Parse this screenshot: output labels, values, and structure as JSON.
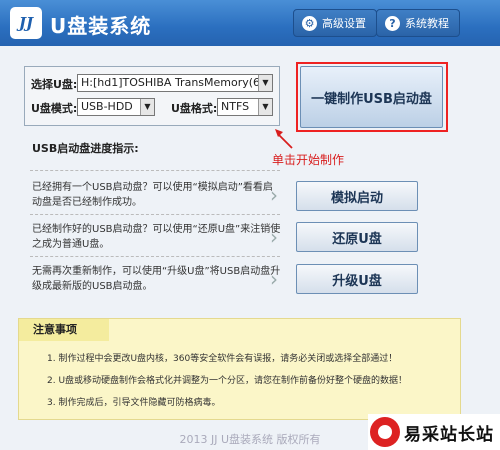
{
  "app": {
    "logo": "JJ",
    "title": "U盘装系统"
  },
  "header": {
    "settings_label": "高级设置",
    "tutorial_label": "系统教程"
  },
  "options": {
    "usb_label": "选择U盘:",
    "usb_value": "H:[hd1]TOSHIBA TransMemory(6.87G",
    "mode_label": "U盘模式:",
    "mode_value": "USB-HDD",
    "format_label": "U盘格式:",
    "format_value": "NTFS"
  },
  "oneclick_label": "一键制作USB启动盘",
  "hint_text": "单击开始制作",
  "progress_title": "USB启动盘进度指示:",
  "actions": [
    {
      "desc": "已经拥有一个USB启动盘？可以使用“模拟启动”看看启动盘是否已经制作成功。",
      "label": "模拟启动"
    },
    {
      "desc": "已经制作好的USB启动盘？可以使用“还原U盘”来注销使之成为普通U盘。",
      "label": "还原U盘"
    },
    {
      "desc": "无需再次重新制作，可以使用“升级U盘”将USB启动盘升级成最新版的USB启动盘。",
      "label": "升级U盘"
    }
  ],
  "notes": {
    "title": "注意事项",
    "items": [
      "1. 制作过程中会更改U盘内核，360等安全软件会有误报，请务必关闭或选择全部通过！",
      "2. U盘或移动硬盘制作会格式化并调整为一个分区，请您在制作前备份好整个硬盘的数据！",
      "3. 制作完成后，引导文件隐藏可防格病毒。"
    ]
  },
  "footer": "2013 JJ U盘装系统 版权所有",
  "watermark_text": "易采站长站",
  "colors": {
    "titlebar": "#2b6fbf",
    "highlight": "#e22222",
    "hint": "#d81e1e",
    "notes_bg": "#fbf6c8"
  }
}
